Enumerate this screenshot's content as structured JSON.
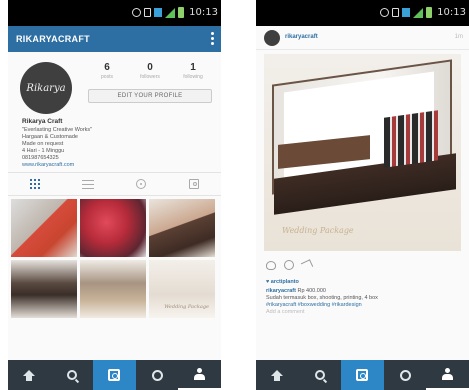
{
  "colors": {
    "accent": "#2d6fa2",
    "nav_bg": "#2f3942",
    "nav_active": "#2d86c6"
  },
  "status_bar": {
    "time": "10:13"
  },
  "profile_screen": {
    "app_title": "RIKARYACRAFT",
    "avatar_text": "Rikarya",
    "stats": [
      {
        "value": "6",
        "label": "posts"
      },
      {
        "value": "0",
        "label": "followers"
      },
      {
        "value": "1",
        "label": "following"
      }
    ],
    "edit_profile_label": "EDIT YOUR PROFILE",
    "bio": {
      "name": "Rikarya Craft",
      "lines": [
        "\"Everlasting Creative Works\"",
        "Hargaan & Customade",
        "Made on request",
        "4 Hari - 1 Minggu",
        "081987654325"
      ],
      "link": "www.rikaryacraft.com"
    },
    "tabs": [
      "grid-icon",
      "list-icon",
      "location-icon",
      "tagged-icon"
    ],
    "photo_caption": "Wedding Package"
  },
  "post_screen": {
    "username": "rikaryacraft",
    "time_ago": "1m",
    "image_script_text": "Wedding Package",
    "likes": "♥ arctiplanto",
    "caption_user": "rikaryacraft",
    "caption_text": "Rp 400.000",
    "caption_line2": "Sudah termasuk box, shooting, printing, 4 box",
    "hashtags": "#rikaryacraft #boxwedding #rikardesign",
    "add_comment": "Add a comment"
  },
  "bottom_nav": [
    "home-icon",
    "search-icon",
    "camera-icon",
    "news-icon",
    "profile-icon"
  ]
}
